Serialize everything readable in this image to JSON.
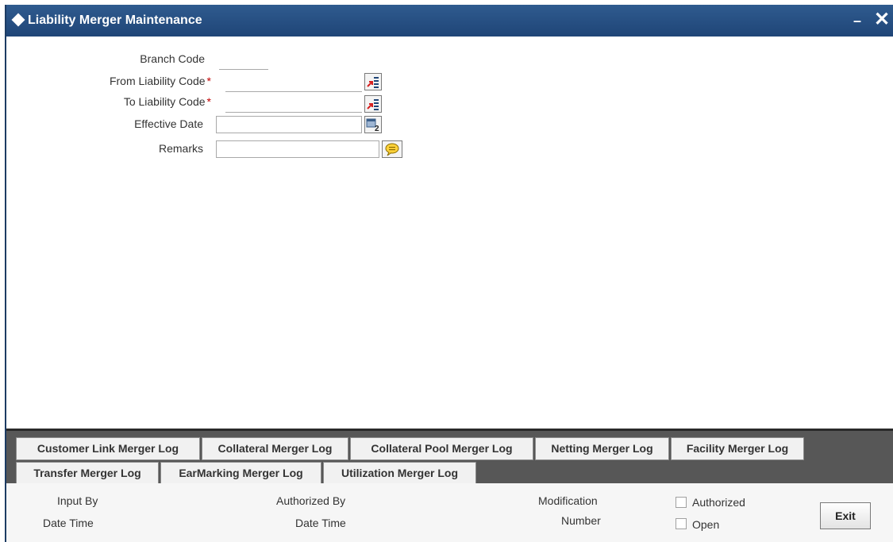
{
  "window": {
    "title": "Liability Merger Maintenance",
    "minimize_glyph": "–",
    "close_glyph": "✕"
  },
  "form": {
    "branch_code_label": "Branch Code",
    "branch_code_value": "",
    "from_liability_code_label": "From Liability Code",
    "from_liability_code_value": "",
    "to_liability_code_label": "To Liability Code",
    "to_liability_code_value": "",
    "effective_date_label": "Effective Date",
    "effective_date_value": "",
    "remarks_label": "Remarks",
    "remarks_value": "",
    "required_marker": "*",
    "icons": {
      "from_lov": "list-of-values-icon",
      "to_lov": "list-of-values-icon",
      "date": "calendar-icon",
      "remarks": "speech-bubble-icon"
    }
  },
  "tabs": {
    "row1": [
      "Customer Link Merger Log",
      "Collateral Merger Log",
      "Collateral Pool Merger Log",
      "Netting Merger Log",
      "Facility Merger Log"
    ],
    "row2": [
      "Transfer Merger Log",
      "EarMarking Merger Log",
      "Utilization Merger Log"
    ]
  },
  "footer": {
    "input_by": "Input By",
    "date_time_1": "Date Time",
    "authorized_by": "Authorized By",
    "date_time_2": "Date Time",
    "modification": "Modification",
    "number": "Number",
    "authorized": "Authorized",
    "open": "Open",
    "exit": "Exit"
  },
  "colors": {
    "titlebar": "#1f4577",
    "tab_strip": "#575757",
    "required": "#c00000"
  }
}
